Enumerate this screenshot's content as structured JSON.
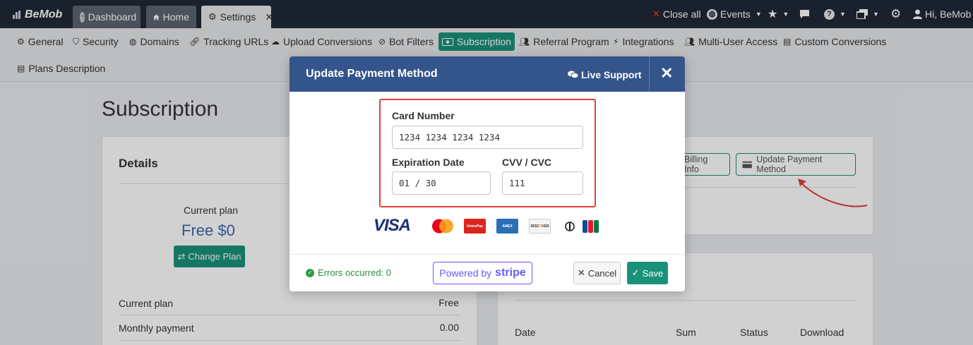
{
  "app": {
    "brand": "BeMob"
  },
  "tabs": [
    {
      "label": "Dashboard",
      "icon": "dashboard-icon"
    },
    {
      "label": "Home",
      "icon": "home-icon"
    },
    {
      "label": "Settings",
      "icon": "gear-icon",
      "active": true
    }
  ],
  "topbar": {
    "close_all": "Close all",
    "events": "Events",
    "user": "Hi, BeMob"
  },
  "settings_nav": [
    {
      "label": "General",
      "icon": "gear-icon"
    },
    {
      "label": "Security",
      "icon": "shield-icon"
    },
    {
      "label": "Domains",
      "icon": "globe-icon"
    },
    {
      "label": "Tracking URLs",
      "icon": "link-icon"
    },
    {
      "label": "Upload Conversions",
      "icon": "cloud-upload-icon"
    },
    {
      "label": "Bot Filters",
      "icon": "ban-icon"
    },
    {
      "label": "Subscription",
      "icon": "money-icon",
      "active": true
    },
    {
      "label": "Referral Program",
      "icon": "users-icon"
    },
    {
      "label": "Integrations",
      "icon": "plug-icon"
    },
    {
      "label": "Multi-User Access",
      "icon": "users-icon"
    },
    {
      "label": "Custom Conversions",
      "icon": "file-icon"
    },
    {
      "label": "Plans Description",
      "icon": "file-icon"
    }
  ],
  "page": {
    "title": "Subscription",
    "details_title": "Details",
    "current_plan_label": "Current plan",
    "current_plan_value": "Free $0",
    "change_plan": "Change Plan",
    "rows": [
      {
        "label": "Current plan",
        "value": "Free"
      },
      {
        "label": "Monthly payment",
        "value": "0.00"
      }
    ],
    "billing_info": "Billing Info",
    "update_payment_method": "Update Payment Method",
    "table_headers": [
      "Date",
      "Sum",
      "Status",
      "Download"
    ]
  },
  "modal": {
    "title": "Update Payment Method",
    "live_support": "Live Support",
    "close": "✕",
    "card_number_label": "Card Number",
    "card_number_value": "1234 1234 1234 1234",
    "expiration_label": "Expiration Date",
    "expiration_value": "01 / 30",
    "cvv_label": "CVV / CVC",
    "cvv_value": "111",
    "card_brands": [
      "VISA",
      "MasterCard",
      "UnionPay",
      "American Express",
      "DISCOVER",
      "Diners Club",
      "JCB"
    ],
    "errors_text": "Errors occurred: 0",
    "powered_by": "Powered by",
    "stripe": "stripe",
    "cancel": "Cancel",
    "save": "Save"
  },
  "colors": {
    "topbar": "#1f2a36",
    "accent_green": "#1a9179",
    "modal_header": "#34558b",
    "highlight_red": "#e0403a",
    "stripe_purple": "#635bff"
  }
}
